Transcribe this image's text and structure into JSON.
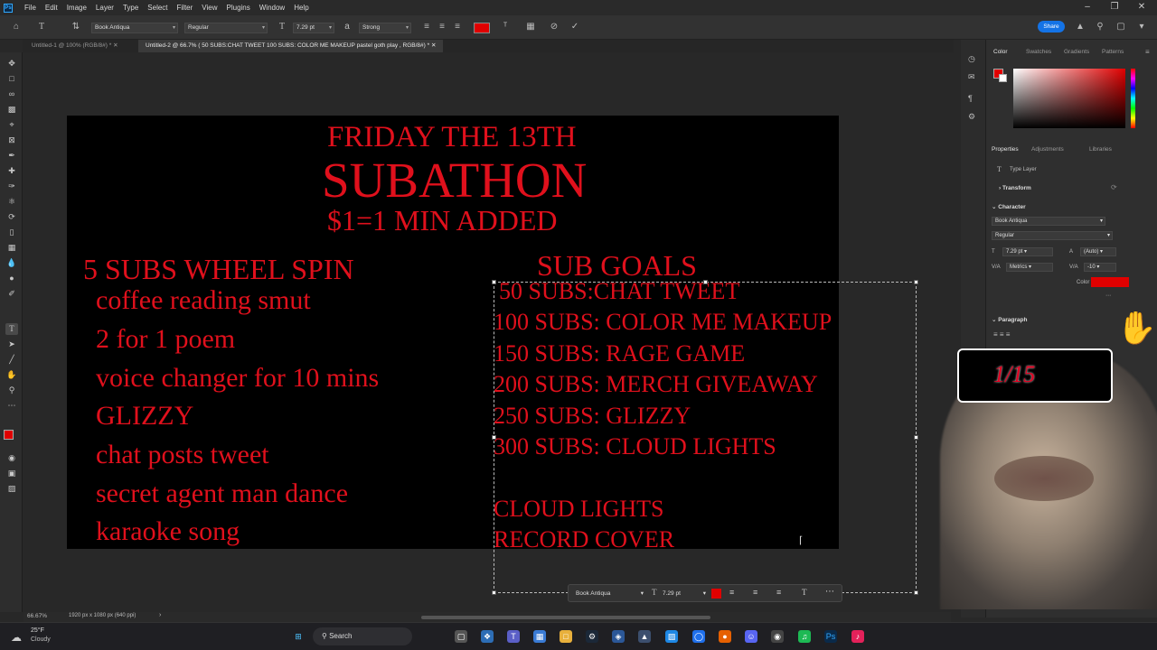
{
  "menubar": {
    "logo": "Ps",
    "items": [
      "File",
      "Edit",
      "Image",
      "Layer",
      "Type",
      "Select",
      "Filter",
      "View",
      "Plugins",
      "Window",
      "Help"
    ]
  },
  "options": {
    "font_family": "Book Antiqua",
    "font_style": "Regular",
    "font_size": "7.29 pt",
    "antialias": "Strong",
    "share": "Share",
    "text_color": "#e00000"
  },
  "tabs": [
    {
      "label": "Untitled-1 @ 100% (RGB/8#) *"
    },
    {
      "label": "Untitled-2 @ 66.7% ( 50 SUBS:CHAT TWEET 100 SUBS: COLOR ME MAKEUP pastel goth play , RGB/8#) *"
    }
  ],
  "document": {
    "title_line1": "FRIDAY THE 13TH",
    "title_line2": "SUBATHON",
    "title_line3": "$1=1 MIN ADDED",
    "wheel_heading": "5 SUBS WHEEL SPIN",
    "wheel_items": [
      "coffee reading smut",
      "2 for 1 poem",
      "voice changer for 10 mins",
      "GLIZZY",
      "chat posts tweet",
      "secret agent man dance",
      "karaoke song"
    ],
    "goals_heading": "SUB GOALS",
    "goals": [
      "50 SUBS:CHAT TWEET",
      "100 SUBS: COLOR ME MAKEUP",
      "150 SUBS: RAGE GAME",
      "200 SUBS: MERCH GIVEAWAY",
      "250 SUBS: GLIZZY",
      "300 SUBS: CLOUD LIGHTS"
    ],
    "extra_lines": [
      "CLOUD LIGHTS",
      "RECORD COVER"
    ],
    "text_color": "#e0101c"
  },
  "floatbar": {
    "font_family": "Book Antiqua",
    "font_size": "7.29 pt",
    "color": "#e00000"
  },
  "panel": {
    "color_tabs": [
      "Color",
      "Swatches",
      "Gradients",
      "Patterns"
    ],
    "prop_tabs": [
      "Properties",
      "Adjustments",
      "Libraries"
    ],
    "type_layer": "Type Layer",
    "transform": "Transform",
    "character": "Character",
    "char_font": "Book Antiqua",
    "char_style": "Regular",
    "char_size": "7.29 pt",
    "leading": "(Auto)",
    "kerning": "Metrics",
    "tracking": "-10",
    "color_label": "Color",
    "paragraph": "Paragraph",
    "char_color": "#e00000"
  },
  "overlay": {
    "sub_counter": "1/15"
  },
  "status": {
    "zoom": "66.67%",
    "doc_size": "1920 px x 1080 px (640 ppi)"
  },
  "taskbar": {
    "temp": "25°F",
    "weather": "Cloudy",
    "search": "Search"
  }
}
